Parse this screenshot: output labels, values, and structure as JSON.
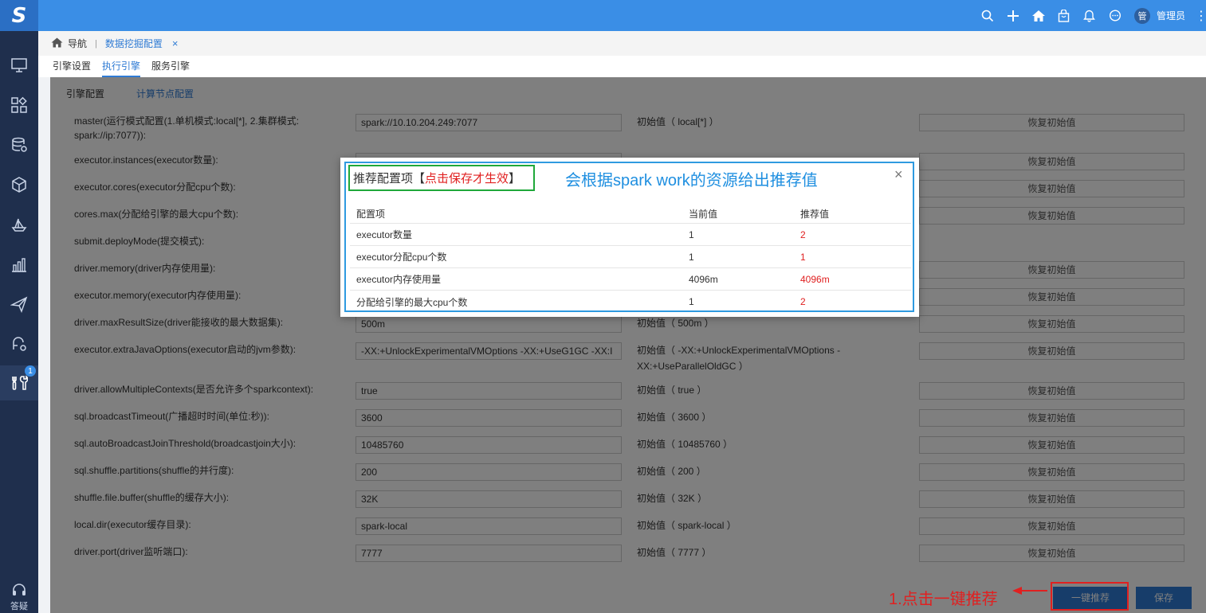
{
  "topbar": {
    "logo": "S",
    "user_avatar": "管",
    "user_name": "管理员",
    "icons": [
      "search-icon",
      "plus-icon",
      "home-icon",
      "bag-icon",
      "bell-icon",
      "chat-icon",
      "more-icon"
    ]
  },
  "sidebar": {
    "items": [
      {
        "icon": "monitor-icon"
      },
      {
        "icon": "apps-icon"
      },
      {
        "icon": "database-icon"
      },
      {
        "icon": "cube-icon"
      },
      {
        "icon": "ship-icon"
      },
      {
        "icon": "chart-icon"
      },
      {
        "icon": "send-icon"
      },
      {
        "icon": "flow-icon"
      },
      {
        "icon": "tools-icon",
        "badge": "1"
      }
    ],
    "bottom_label": "答疑"
  },
  "breadcrumb": {
    "nav": "导航",
    "tab": "数据挖掘配置",
    "close": "×"
  },
  "tabs": [
    {
      "label": "引擎设置",
      "active": false
    },
    {
      "label": "执行引擎",
      "active": true
    },
    {
      "label": "服务引擎",
      "active": false
    }
  ],
  "subtabs": [
    {
      "label": "引擎配置",
      "active": false
    },
    {
      "label": "计算节点配置",
      "active": true
    }
  ],
  "form": {
    "reset_label": "恢复初始值",
    "rows": [
      {
        "label": "master(运行模式配置(1.单机模式:local[*], 2.集群模式: spark://ip:7077)):",
        "value": "spark://10.10.204.249:7077",
        "init": "初始值（ local[*] ）"
      },
      {
        "label": "executor.instances(executor数量):",
        "value": "",
        "init": ""
      },
      {
        "label": "executor.cores(executor分配cpu个数):",
        "value": "",
        "init": ""
      },
      {
        "label": "cores.max(分配给引擎的最大cpu个数):",
        "value": "",
        "init": ""
      },
      {
        "label": "submit.deployMode(提交模式):",
        "value": "",
        "init": ""
      },
      {
        "label": "driver.memory(driver内存使用量):",
        "value": "",
        "init": ""
      },
      {
        "label": "executor.memory(executor内存使用量):",
        "value": "",
        "init": ""
      },
      {
        "label": "driver.maxResultSize(driver能接收的最大数据集):",
        "value": "500m",
        "init": "初始值（ 500m ）"
      },
      {
        "label": "executor.extraJavaOptions(executor启动的jvm参数):",
        "value": "-XX:+UnlockExperimentalVMOptions -XX:+UseG1GC -XX:I",
        "init": "初始值（ -XX:+UnlockExperimentalVMOptions -XX:+UseParallelOldGC ）"
      },
      {
        "label": "driver.allowMultipleContexts(是否允许多个sparkcontext):",
        "value": "true",
        "init": "初始值（ true ）"
      },
      {
        "label": "sql.broadcastTimeout(广播超时时间(单位:秒)):",
        "value": "3600",
        "init": "初始值（ 3600 ）"
      },
      {
        "label": "sql.autoBroadcastJoinThreshold(broadcastjoin大小):",
        "value": "10485760",
        "init": "初始值（ 10485760 ）"
      },
      {
        "label": "sql.shuffle.partitions(shuffle的并行度):",
        "value": "200",
        "init": "初始值（ 200 ）"
      },
      {
        "label": "shuffle.file.buffer(shuffle的缓存大小):",
        "value": "32K",
        "init": "初始值（ 32K ）"
      },
      {
        "label": "local.dir(executor缓存目录):",
        "value": "spark-local",
        "init": "初始值（ spark-local ）"
      },
      {
        "label": "driver.port(driver监听端口):",
        "value": "7777",
        "init": "初始值（ 7777 ）"
      }
    ]
  },
  "footer": {
    "recommend_label": "一键推荐",
    "save_label": "保存"
  },
  "modal": {
    "title_prefix": "推荐配置项【",
    "title_red": "点击保存才生效",
    "title_suffix": "】",
    "note": "会根据spark work的资源给出推荐值",
    "close": "×",
    "headers": [
      "配置项",
      "当前值",
      "推荐值"
    ],
    "rows": [
      {
        "item": "executor数量",
        "current": "1",
        "recommended": "2"
      },
      {
        "item": "executor分配cpu个数",
        "current": "1",
        "recommended": "1"
      },
      {
        "item": "executor内存使用量",
        "current": "4096m",
        "recommended": "4096m"
      },
      {
        "item": "分配给引擎的最大cpu个数",
        "current": "1",
        "recommended": "2"
      }
    ]
  },
  "annotation": {
    "text": "1.点击一键推荐"
  },
  "colors": {
    "topbar": "#3a8ee6",
    "sidebar": "#1f2f4d",
    "accent": "#2f7bd4",
    "red": "#e02020",
    "green_box": "#1fa83a",
    "blue_box": "#2f9ae0"
  }
}
